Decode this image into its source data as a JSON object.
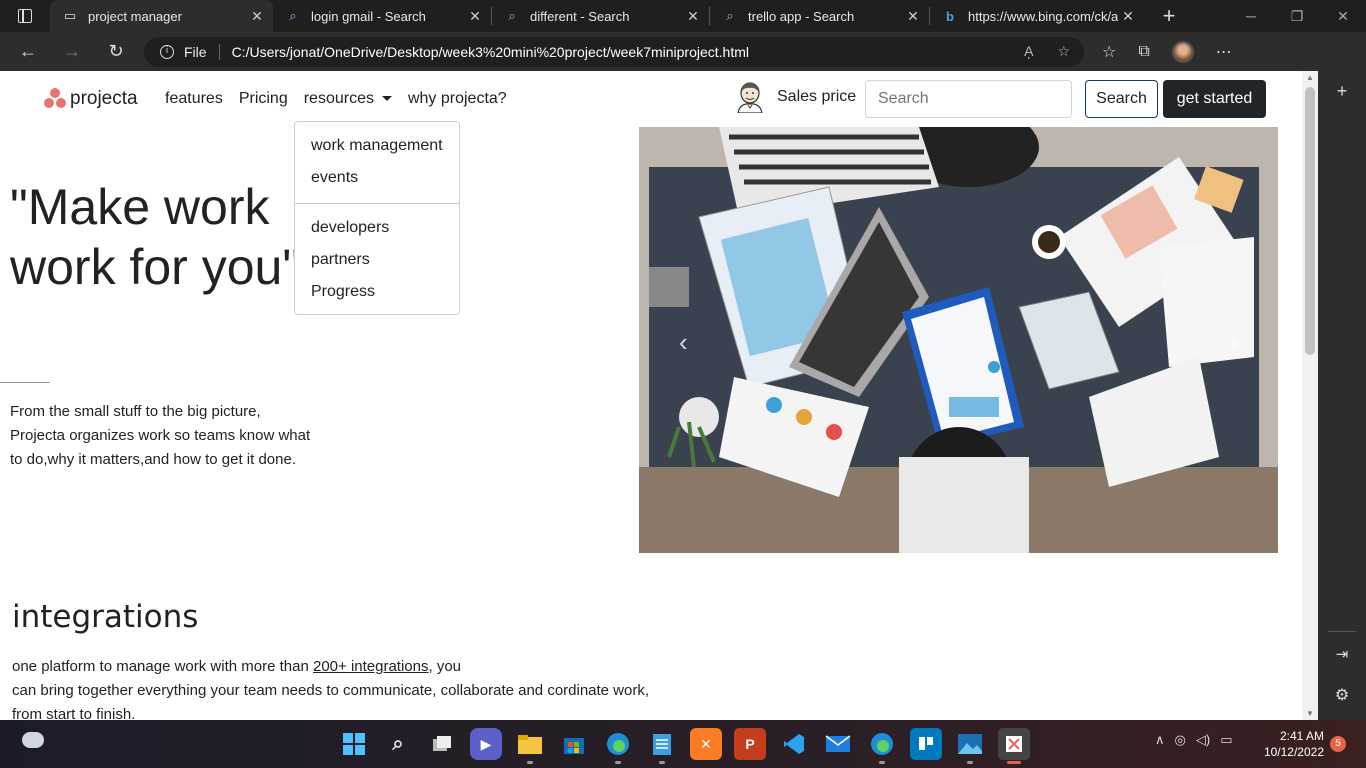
{
  "browser": {
    "tabs": [
      {
        "title": "project manager",
        "active": true
      },
      {
        "title": "login gmail - Search",
        "active": false
      },
      {
        "title": "different - Search",
        "active": false
      },
      {
        "title": "trello app - Search",
        "active": false
      },
      {
        "title": "https://www.bing.com/ck/a?!",
        "active": false
      }
    ],
    "address": {
      "scheme_label": "File",
      "url": "C:/Users/jonat/OneDrive/Desktop/week3%20mini%20project/week7miniproject.html"
    }
  },
  "site": {
    "brand": "projecta",
    "brand_color": "#e8736f",
    "nav": {
      "features": "features",
      "pricing": "Pricing",
      "resources": "resources",
      "why": "why projecta?"
    },
    "sales_price": "Sales price",
    "search_placeholder": "Search",
    "search_button": "Search",
    "cta_button": "get started",
    "dropdown": {
      "group1": [
        "work management",
        "events"
      ],
      "group2": [
        "developers",
        "partners",
        "Progress"
      ]
    },
    "headline_line1": "\"Make work",
    "headline_line2": "work for you\"",
    "lede_line1": "From the small stuff to the big picture,",
    "lede_line2": "Projecta organizes work so teams know what",
    "lede_line3": "to do,why it matters,and how to get it done.",
    "integrations": {
      "title": "integrations",
      "text_before": "one platform to manage work with more than ",
      "link": "200+ integrations",
      "text_after": ", you",
      "line2": "can bring together everything your team needs to communicate, collaborate and cordinate work,",
      "line3": "from start to finish."
    },
    "carousel": {
      "prev": "‹",
      "next": "›"
    }
  },
  "taskbar": {
    "time": "2:41 AM",
    "date": "10/12/2022",
    "notifications": "5"
  }
}
